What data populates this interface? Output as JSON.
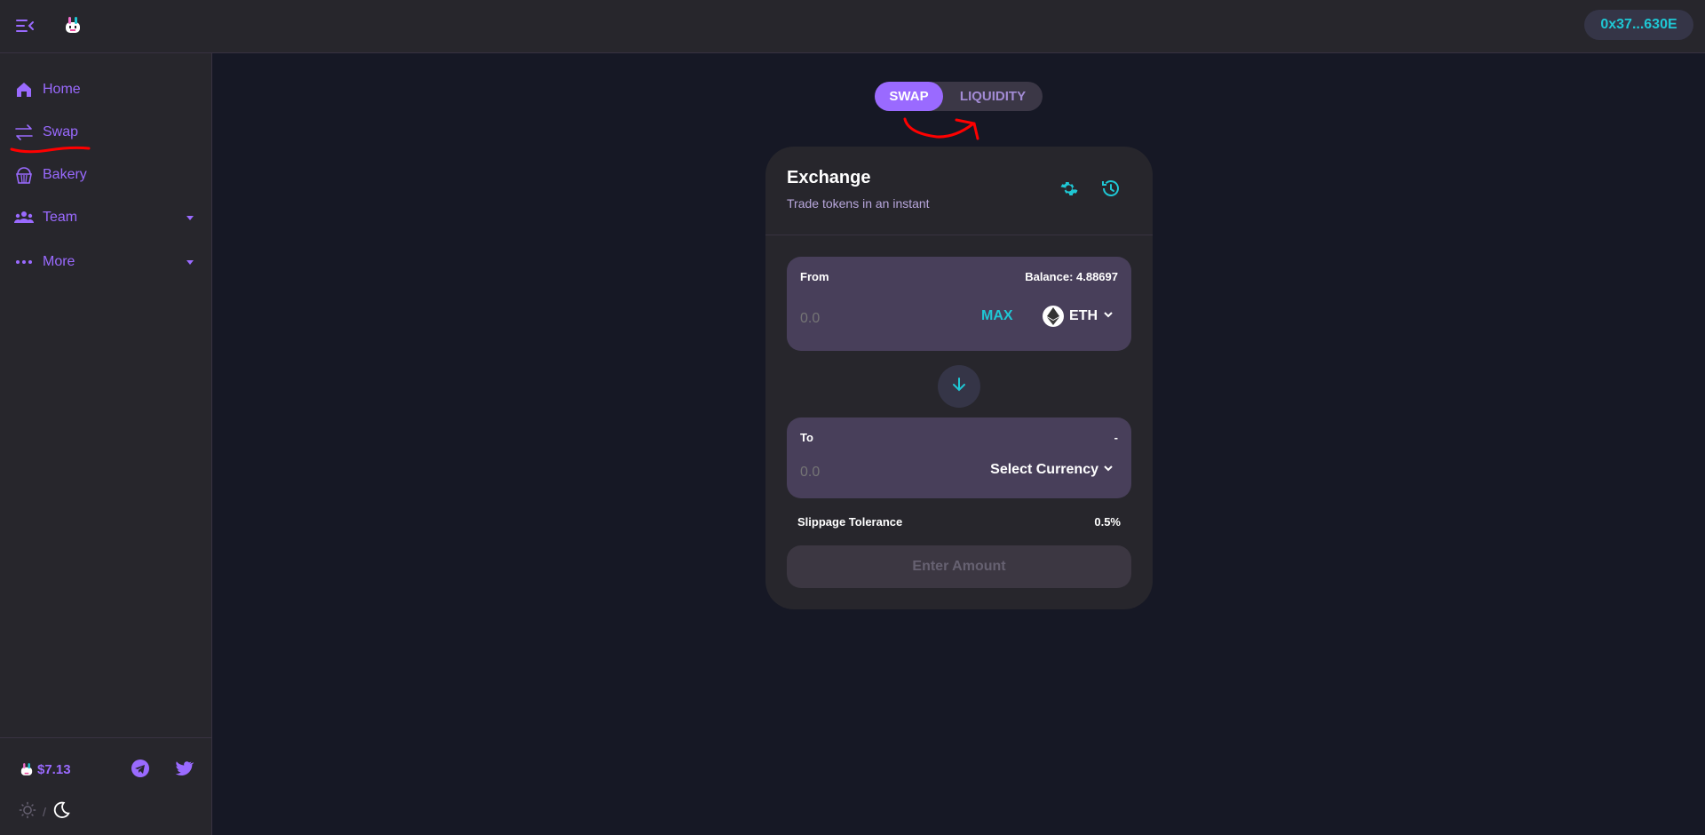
{
  "header": {
    "wallet_address": "0x37...630E"
  },
  "sidebar": {
    "items": [
      {
        "label": "Home",
        "icon": "home-icon"
      },
      {
        "label": "Swap",
        "icon": "swap-icon"
      },
      {
        "label": "Bakery",
        "icon": "cupcake-icon"
      },
      {
        "label": "Team",
        "icon": "team-icon",
        "expandable": true
      },
      {
        "label": "More",
        "icon": "more-icon",
        "expandable": true
      }
    ],
    "token_price": "$7.13",
    "theme_separator": "/"
  },
  "tabs": {
    "swap": "SWAP",
    "liquidity": "LIQUIDITY",
    "active": "SWAP"
  },
  "exchange": {
    "title": "Exchange",
    "subtitle": "Trade tokens in an instant",
    "from": {
      "label": "From",
      "balance": "Balance: 4.88697",
      "placeholder": "0.0",
      "max_label": "MAX",
      "token": "ETH"
    },
    "to": {
      "label": "To",
      "right_text": "-",
      "placeholder": "0.0",
      "select_label": "Select Currency"
    },
    "slippage_label": "Slippage Tolerance",
    "slippage_value": "0.5%",
    "submit_label": "Enter Amount"
  },
  "colors": {
    "background": "#161825",
    "panel": "#27262c",
    "accent": "#9a6aff",
    "secondary": "#1fc7d4",
    "input_box": "#483f5a",
    "annotation": "#ff0000"
  }
}
